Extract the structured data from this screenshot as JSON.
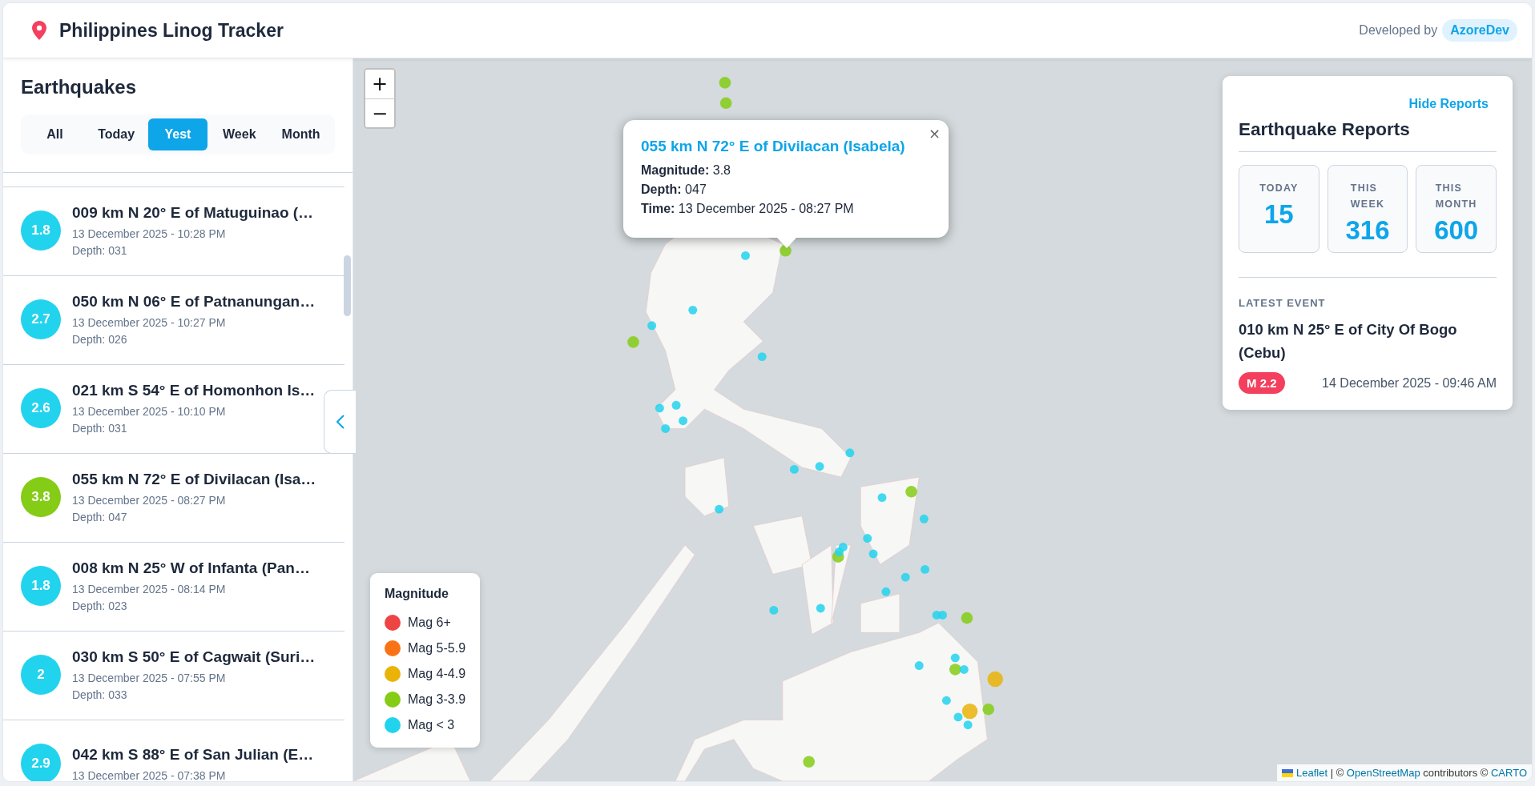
{
  "header": {
    "title": "Philippines Linog Tracker",
    "credit_label": "Developed by",
    "credit_link": "AzoreDev"
  },
  "sidebar": {
    "title": "Earthquakes",
    "filters": [
      {
        "label": "All",
        "selected": false
      },
      {
        "label": "Today",
        "selected": false
      },
      {
        "label": "Yest",
        "selected": true
      },
      {
        "label": "Week",
        "selected": false
      },
      {
        "label": "Month",
        "selected": false
      }
    ],
    "events": [
      {
        "magnitude": "1.8",
        "color": "#22d3ee",
        "title": "009 km N 20° E of Matuguinao (…",
        "time": "13 December 2025 - 10:28 PM",
        "depth": "Depth: 031"
      },
      {
        "magnitude": "2.7",
        "color": "#22d3ee",
        "title": "050 km N 06° E of Patnanungan…",
        "time": "13 December 2025 - 10:27 PM",
        "depth": "Depth: 026"
      },
      {
        "magnitude": "2.6",
        "color": "#22d3ee",
        "title": "021 km S 54° E of Homonhon Is…",
        "time": "13 December 2025 - 10:10 PM",
        "depth": "Depth: 031"
      },
      {
        "magnitude": "3.8",
        "color": "#84cc16",
        "title": "055 km N 72° E of Divilacan (Isa…",
        "time": "13 December 2025 - 08:27 PM",
        "depth": "Depth: 047"
      },
      {
        "magnitude": "1.8",
        "color": "#22d3ee",
        "title": "008 km N 25° W of Infanta (Pan…",
        "time": "13 December 2025 - 08:14 PM",
        "depth": "Depth: 023"
      },
      {
        "magnitude": "2",
        "color": "#22d3ee",
        "title": "030 km S 50° E of Cagwait (Suri…",
        "time": "13 December 2025 - 07:55 PM",
        "depth": "Depth: 033"
      },
      {
        "magnitude": "2.9",
        "color": "#22d3ee",
        "title": "042 km S 88° E of San Julian (E…",
        "time": "13 December 2025 - 07:38 PM"
      }
    ]
  },
  "map": {
    "zoom_in": "+",
    "zoom_out": "−",
    "popup": {
      "title": "055 km N 72° E of Divilacan (Isabela)",
      "close": "×",
      "lines": [
        {
          "label": "Magnitude:",
          "value": "3.8"
        },
        {
          "label": "Depth:",
          "value": "047"
        },
        {
          "label": "Time:",
          "value": "13 December 2025 - 08:27 PM"
        }
      ]
    },
    "legend": {
      "title": "Magnitude",
      "items": [
        {
          "label": "Mag 6+",
          "color": "#ef4444"
        },
        {
          "label": "Mag 5-5.9",
          "color": "#f97316"
        },
        {
          "label": "Mag 4-4.9",
          "color": "#eab308"
        },
        {
          "label": "Mag 3-3.9",
          "color": "#84cc16"
        },
        {
          "label": "Mag < 3",
          "color": "#22d3ee"
        }
      ]
    },
    "attribution": [
      {
        "kind": "link",
        "text": "Leaflet"
      },
      {
        "kind": "text",
        "text": " | © "
      },
      {
        "kind": "link",
        "text": "OpenStreetMap"
      },
      {
        "kind": "text",
        "text": " contributors © "
      },
      {
        "kind": "link",
        "text": "CARTO"
      }
    ]
  },
  "reports": {
    "toggle": "Hide Reports",
    "title": "Earthquake Reports",
    "stats": [
      {
        "label": "TODAY",
        "value": "15"
      },
      {
        "label": "THIS WEEK",
        "value": "316"
      },
      {
        "label": "THIS MONTH",
        "value": "600"
      }
    ],
    "latest_label": "LATEST EVENT",
    "latest_title": "010 km N 25° E of City Of Bogo (Cebu)",
    "latest_magnitude": "M 2.2",
    "latest_time": "14 December 2025 - 09:46 AM"
  }
}
